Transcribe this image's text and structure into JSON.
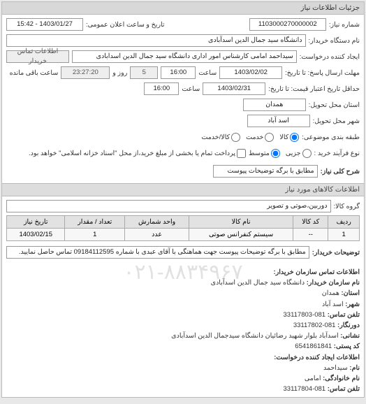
{
  "panel_title": "جزئیات اطلاعات نیاز",
  "fields": {
    "need_no_label": "شماره نیاز:",
    "need_no": "1103000270000002",
    "announce_label": "تاریخ و ساعت اعلان عمومی:",
    "announce": "1403/01/27 - 15:42",
    "buyer_label": "نام دستگاه خریدار:",
    "buyer": "دانشگاه سید جمال الدین اسدآبادی",
    "creator_label": "ایجاد کننده درخواست:",
    "creator": "سیداحمد امامی کارشناس امور اداری دانشگاه سید جمال الدین اسدابادی",
    "contact_btn": "اطلاعات تماس خریدار",
    "deadline_label": "مهلت ارسال پاسخ: تا تاریخ:",
    "deadline_date": "1403/02/02",
    "deadline_time_label": "ساعت",
    "deadline_time": "16:00",
    "remain_days": "5",
    "remain_days_label": "روز و",
    "remain_time": "23:27:20",
    "remain_time_label": "ساعت باقی مانده",
    "validity_label": "حداقل تاریخ اعتبار قیمت: تا تاریخ:",
    "validity_date": "1403/02/31",
    "validity_time_label": "ساعت",
    "validity_time": "16:00",
    "province_label": "استان محل تحویل:",
    "province": "همدان",
    "city_label": "شهر محل تحویل:",
    "city": "اسد آباد",
    "category_label": "طبقه بندی موضوعی:",
    "radio_goods": "کالا",
    "radio_service": "خدمت",
    "radio_goods_service": "کالا/خدمت",
    "buy_type_label": "نوع فرآیند خرید :",
    "radio_small": "جزیی",
    "radio_medium": "متوسط",
    "buy_note": "پرداخت تمام یا بخشی از مبلغ خرید،از محل \"اسناد خزانه اسلامی\" خواهد بود.",
    "desc_label": "شرح کلی نیاز:",
    "desc": "مطابق با برگه توضیحات پیوست"
  },
  "items_header": "اطلاعات کالاهای مورد نیاز",
  "group_label": "گروه کالا:",
  "group_value": "دوربین،صوتی و تصویر",
  "table": {
    "headers": [
      "ردیف",
      "کد کالا",
      "نام کالا",
      "واحد شمارش",
      "تعداد / مقدار",
      "تاریخ نیاز"
    ],
    "rows": [
      [
        "1",
        "--",
        "سیستم کنفرانس صوتی",
        "عدد",
        "1",
        "1403/02/15"
      ]
    ]
  },
  "buyer_notes_label": "توضیحات خریدار:",
  "buyer_notes": "مطابق با برگه توضیحات پیوست جهت هماهنگی با آقای عبدی با شماره 09184112595 تماس حاصل نمایید.",
  "contact": {
    "title": "اطلاعات تماس سازمان خریدار:",
    "org_label": "نام سازمان خریدار:",
    "org": "دانشگاه سید جمال الدین اسدآبادی",
    "province_label": "استان:",
    "province": "همدان",
    "city_label": "شهر:",
    "city": "اسد آباد",
    "phone_label": "تلفن تماس:",
    "phone": "081-33117803",
    "fax_label": "دورنگار:",
    "fax": "081-33117802",
    "address_label": "نشانی:",
    "address": "اسدآباد بلوار شهید رضائیان دانشگاه سیدجمال الدین اسدآبادی",
    "postcode_label": "کد پستی:",
    "postcode": "6541861841",
    "creator_title": "اطلاعات ایجاد کننده درخواست:",
    "name_label": "نام:",
    "name": "سیداحمد",
    "lastname_label": "نام خانوادگی:",
    "lastname": "امامی",
    "creator_phone_label": "تلفن تماس:",
    "creator_phone": "081-33117804"
  },
  "watermark": "۰۲۱-۸۸۳۴۹۶۷"
}
